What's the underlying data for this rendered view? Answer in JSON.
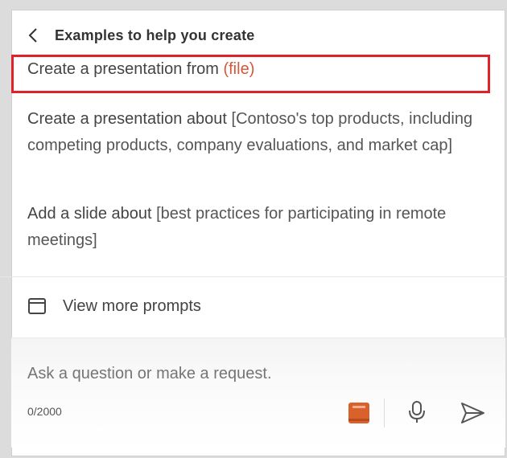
{
  "header": {
    "back_icon": "chevron-left-icon",
    "title": "Examples to help you create"
  },
  "prompts": [
    {
      "text": "Create a presentation from ",
      "param": "(file)"
    },
    {
      "text": "Create a presentation about ",
      "param": "[Contoso's top products, including competing products, company evaluations, and market cap]"
    },
    {
      "text": "Add a slide about ",
      "param": "[best practices for participating in remote meetings]"
    }
  ],
  "view_more": {
    "icon": "prompt-book-icon",
    "label": "View more prompts"
  },
  "compose": {
    "placeholder": "Ask a question or make a request.",
    "counter": "0/2000",
    "book_icon": "notebook-icon",
    "mic_icon": "microphone-icon",
    "send_icon": "send-icon"
  },
  "colors": {
    "highlight": "#e0212a",
    "accent": "#d4583a",
    "book_icon": "#d9622c"
  }
}
